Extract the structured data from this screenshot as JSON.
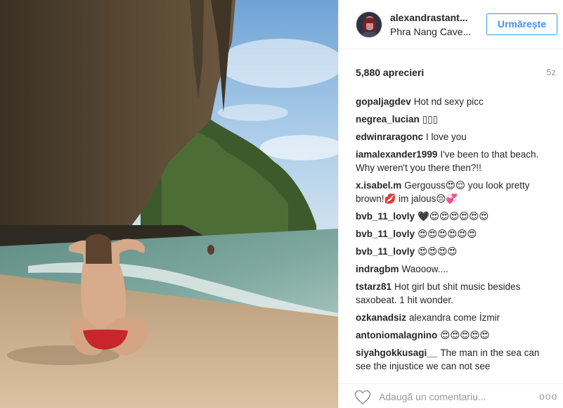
{
  "post": {
    "username": "alexandrastant...",
    "location": "Phra Nang Cave...",
    "follow_label": "Urmărește",
    "likes": "5,880 aprecieri",
    "time_ago": "5z"
  },
  "comments": [
    {
      "user": "gopaljagdev",
      "text": "Hot nd sexy picc"
    },
    {
      "user": "negrea_lucian",
      "text": "▯▯▯"
    },
    {
      "user": "edwinraragonc",
      "text": "I love you"
    },
    {
      "user": "iamalexander1999",
      "text": "I've been to that beach. Why weren't you there then?!!"
    },
    {
      "user": "x.isabel.m",
      "text": "Gergouss😍😌 you look pretty brown!💋 im jalous😔💞"
    },
    {
      "user": "bvb_11_lovly",
      "text": "🖤😍😍😍😍😍😍"
    },
    {
      "user": "bvb_11_lovly",
      "text": "😍😍😍😍😍😍"
    },
    {
      "user": "bvb_11_lovly",
      "text": "😍😍😍😍"
    },
    {
      "user": "indragbm",
      "text": "Waooow...."
    },
    {
      "user": "tstarz81",
      "text": "Hot girl but shit music besides saxobeat. 1 hit wonder."
    },
    {
      "user": "ozkanadsiz",
      "text": "alexandra come İzmir"
    },
    {
      "user": "antoniomalagnino",
      "text": "😍😍😍😍😍"
    },
    {
      "user": "siyahgokkusagi__",
      "text": "The man in the sea can see the injustice we can not see"
    }
  ],
  "footer": {
    "comment_placeholder": "Adaugă un comentariu...",
    "more_label": "ooo"
  },
  "icons": {
    "like": "heart-icon",
    "more": "more-options-icon"
  },
  "colors": {
    "accent": "#3897f0",
    "muted": "#999999",
    "text": "#262626",
    "border": "#efefef"
  }
}
